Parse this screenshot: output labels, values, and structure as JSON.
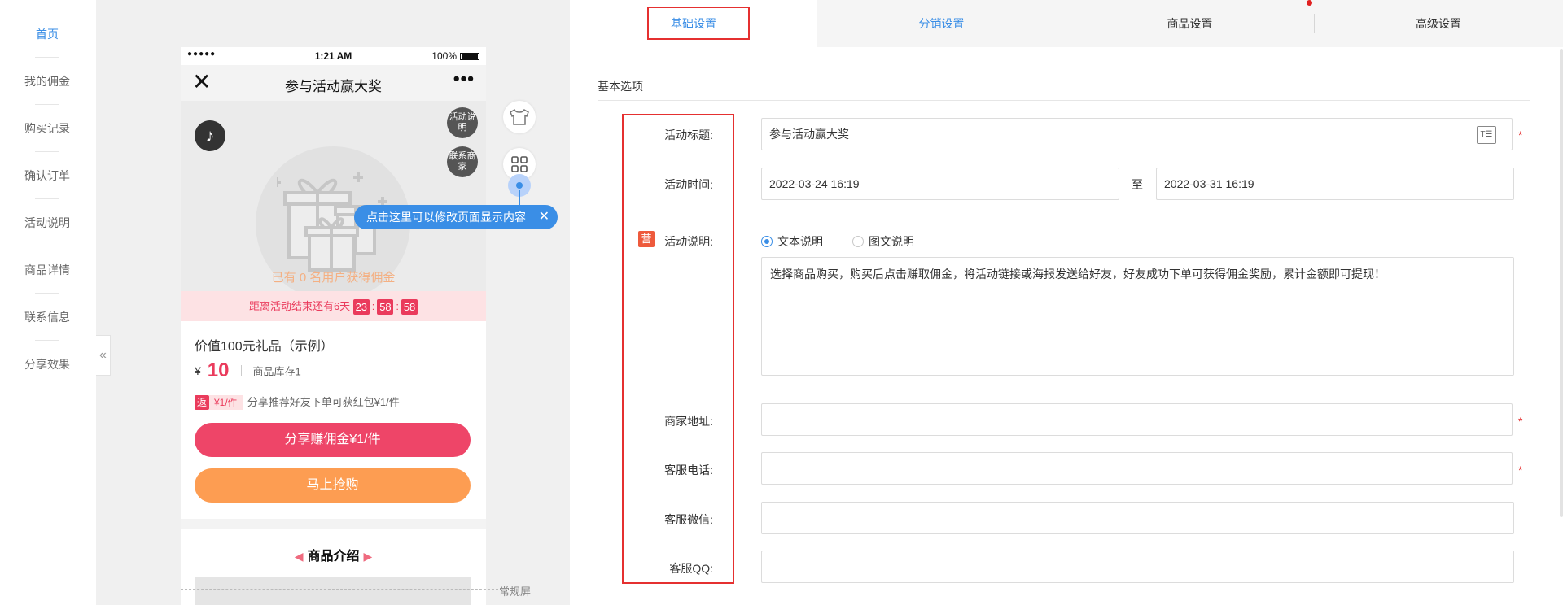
{
  "nav": {
    "items": [
      "首页",
      "我的佣金",
      "购买记录",
      "确认订单",
      "活动说明",
      "商品详情",
      "联系信息",
      "分享效果"
    ]
  },
  "phone": {
    "status_time": "1:21 AM",
    "status_battery": "100%",
    "title": "参与活动赢大奖",
    "bubble_1": "活动说明",
    "bubble_2": "联系商家",
    "users_line": "已有 0 名用户获得佣金",
    "countdown_label": "距离活动结束还有6天",
    "countdown_h": "23",
    "countdown_m": "58",
    "countdown_s": "58",
    "product_name": "价值100元礼品（示例）",
    "currency": "¥",
    "price": "10",
    "stock": "商品库存1",
    "rebate_tag": "返",
    "rebate_amount": "¥1/件",
    "rebate_text": "分享推荐好友下单可获红包¥1/件",
    "share_button": "分享赚佣金¥1/件",
    "buy_button": "马上抢购",
    "intro_title": "商品介绍"
  },
  "preview": {
    "collapse_icon": "«",
    "tooltip": "点击这里可以修改页面显示内容",
    "normal_screen": "常规屏"
  },
  "tabs": [
    "基础设置",
    "分销设置",
    "商品设置",
    "高级设置"
  ],
  "form": {
    "section_title": "基本选项",
    "title_label": "活动标题:",
    "title_value": "参与活动赢大奖",
    "time_label": "活动时间:",
    "start_time": "2022-03-24 16:19",
    "to_text": "至",
    "end_time": "2022-03-31 16:19",
    "desc_badge": "营",
    "desc_label": "活动说明:",
    "radio_text": "文本说明",
    "radio_image": "图文说明",
    "desc_text": "选择商品购买，购买后点击赚取佣金，将活动链接或海报发送给好友，好友成功下单可获得佣金奖励，累计金额即可提现！",
    "address_label": "商家地址:",
    "phone_label": "客服电话:",
    "wechat_label": "客服微信:",
    "qq_label": "客服QQ:",
    "required_mark": "*"
  }
}
